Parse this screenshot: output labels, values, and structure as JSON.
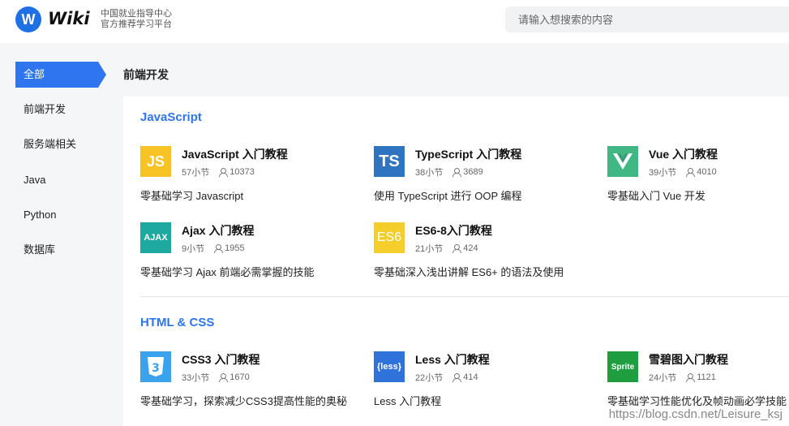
{
  "header": {
    "logo_letter": "W",
    "logo_text": "Wiki",
    "tagline_line1": "中国就业指导中心",
    "tagline_line2": "官方推荐学习平台",
    "search_placeholder": "请输入想搜索的内容"
  },
  "sidebar": {
    "items": [
      {
        "label": "全部",
        "active": true
      },
      {
        "label": "前端开发",
        "active": false
      },
      {
        "label": "服务端相关",
        "active": false
      },
      {
        "label": "Java",
        "active": false
      },
      {
        "label": "Python",
        "active": false
      },
      {
        "label": "数据库",
        "active": false
      }
    ]
  },
  "main": {
    "breadcrumb": "前端开发",
    "sections": [
      {
        "title": "JavaScript",
        "cards": [
          {
            "icon_text": "JS",
            "icon_name": "javascript-icon",
            "icon_bg": "#f7c325",
            "title": "JavaScript 入门教程",
            "sections": "57小节",
            "learners": "10373",
            "desc": "零基础学习 Javascript"
          },
          {
            "icon_text": "TS",
            "icon_name": "typescript-icon",
            "icon_bg": "#2f74c0",
            "title": "TypeScript 入门教程",
            "sections": "38小节",
            "learners": "3689",
            "desc": "使用 TypeScript 进行 OOP 编程"
          },
          {
            "icon_text": "V",
            "icon_name": "vue-icon",
            "icon_bg": "#41b883",
            "title": "Vue 入门教程",
            "sections": "39小节",
            "learners": "4010",
            "desc": "零基础入门 Vue 开发"
          },
          {
            "icon_text": "AJAX",
            "icon_name": "ajax-icon",
            "icon_bg": "#1ea9a0",
            "title": "Ajax 入门教程",
            "sections": "9小节",
            "learners": "1955",
            "desc": "零基础学习 Ajax 前端必需掌握的技能"
          },
          {
            "icon_text": "ES6",
            "icon_name": "es6-icon",
            "icon_bg": "#f6ce2c",
            "title": "ES6-8入门教程",
            "sections": "21小节",
            "learners": "424",
            "desc": "零基础深入浅出讲解 ES6+ 的语法及使用"
          }
        ]
      },
      {
        "title": "HTML & CSS",
        "cards": [
          {
            "icon_text": "3",
            "icon_name": "css3-icon",
            "icon_bg": "#2d8ee6",
            "title": "CSS3 入门教程",
            "sections": "33小节",
            "learners": "1670",
            "desc": "零基础学习，探索减少CSS3提高性能的奥秘"
          },
          {
            "icon_text": "{less}",
            "icon_name": "less-icon",
            "icon_bg": "#2f72d9",
            "title": "Less 入门教程",
            "sections": "22小节",
            "learners": "414",
            "desc": "Less 入门教程"
          },
          {
            "icon_text": "Sprite",
            "icon_name": "sprite-icon",
            "icon_bg": "#1f9e3f",
            "title": "雪碧图入门教程",
            "sections": "24小节",
            "learners": "1121",
            "desc": "零基础学习性能优化及帧动画必学技能"
          }
        ]
      }
    ]
  },
  "watermark": "https://blog.csdn.net/Leisure_ksj"
}
